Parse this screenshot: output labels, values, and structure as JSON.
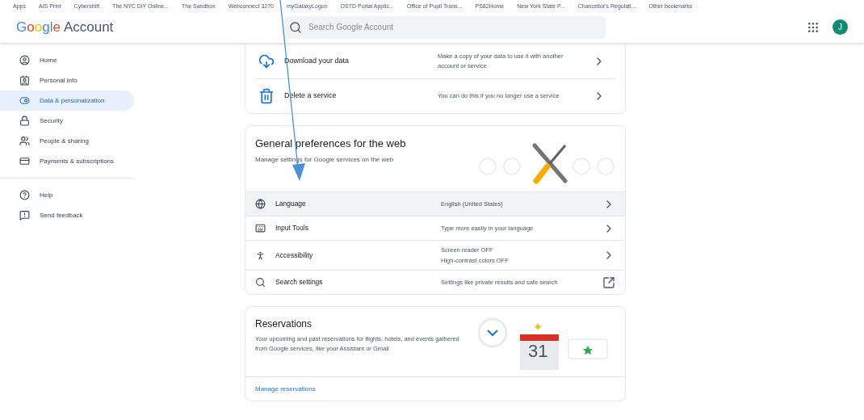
{
  "bookmarks": [
    "Apps",
    "AIS Print",
    "Cybershift",
    "The NYC DiY Online...",
    "The Sandbox",
    "Webconnect 3270",
    "myGalaxyLogon",
    "OSTD Portal Applic...",
    "Office of Pupil Trans...",
    "PS82Home",
    "New York State P...",
    "Chancellor's Regulati...",
    "Other bookmarks"
  ],
  "header": {
    "logo": "Google",
    "title": "Account",
    "search": {
      "placeholder": "Search Google Account"
    },
    "avatar": "J"
  },
  "sidebar": {
    "sections": [
      [
        {
          "label": "Home",
          "selected": false
        },
        {
          "label": "Personal info",
          "selected": false
        },
        {
          "label": "Data & personalization",
          "selected": true
        },
        {
          "label": "Security",
          "selected": false
        },
        {
          "label": "People & sharing",
          "selected": false
        },
        {
          "label": "Payments & subscriptions",
          "selected": false
        }
      ],
      [
        {
          "label": "Help",
          "selected": false
        },
        {
          "label": "Send feedback",
          "selected": false
        }
      ]
    ]
  },
  "data_card": {
    "rows": [
      {
        "title": "Download your data",
        "description": [
          "Make a copy of your data to use it with another",
          "account or service"
        ]
      },
      {
        "title": "Delete a service",
        "description": [
          "You can do this if you no longer use a service"
        ]
      }
    ]
  },
  "preferences_card": {
    "title": "General preferences for the web",
    "subtitle": "Manage settings for Google services on the web",
    "rows": [
      {
        "title": "Language",
        "description": [
          "English (United States)"
        ],
        "kind": "link",
        "selected": true
      },
      {
        "title": "Input Tools",
        "description": [
          "Type more easily in your language"
        ],
        "kind": "link",
        "selected": false
      },
      {
        "title": "Accessibility",
        "description": [
          "Screen reader OFF",
          "High-contrast colors OFF"
        ],
        "kind": "link",
        "selected": false
      },
      {
        "title": "Search settings",
        "description": [
          "Settings like private results and safe search"
        ],
        "kind": "external",
        "selected": false
      }
    ]
  },
  "reservations_card": {
    "title": "Reservations",
    "description": "Your upcoming and past reservations for flights, hotels, and events gathered from Google services, like your Assistant or Gmail",
    "calendar_day": "31",
    "link": "Manage reservations"
  }
}
